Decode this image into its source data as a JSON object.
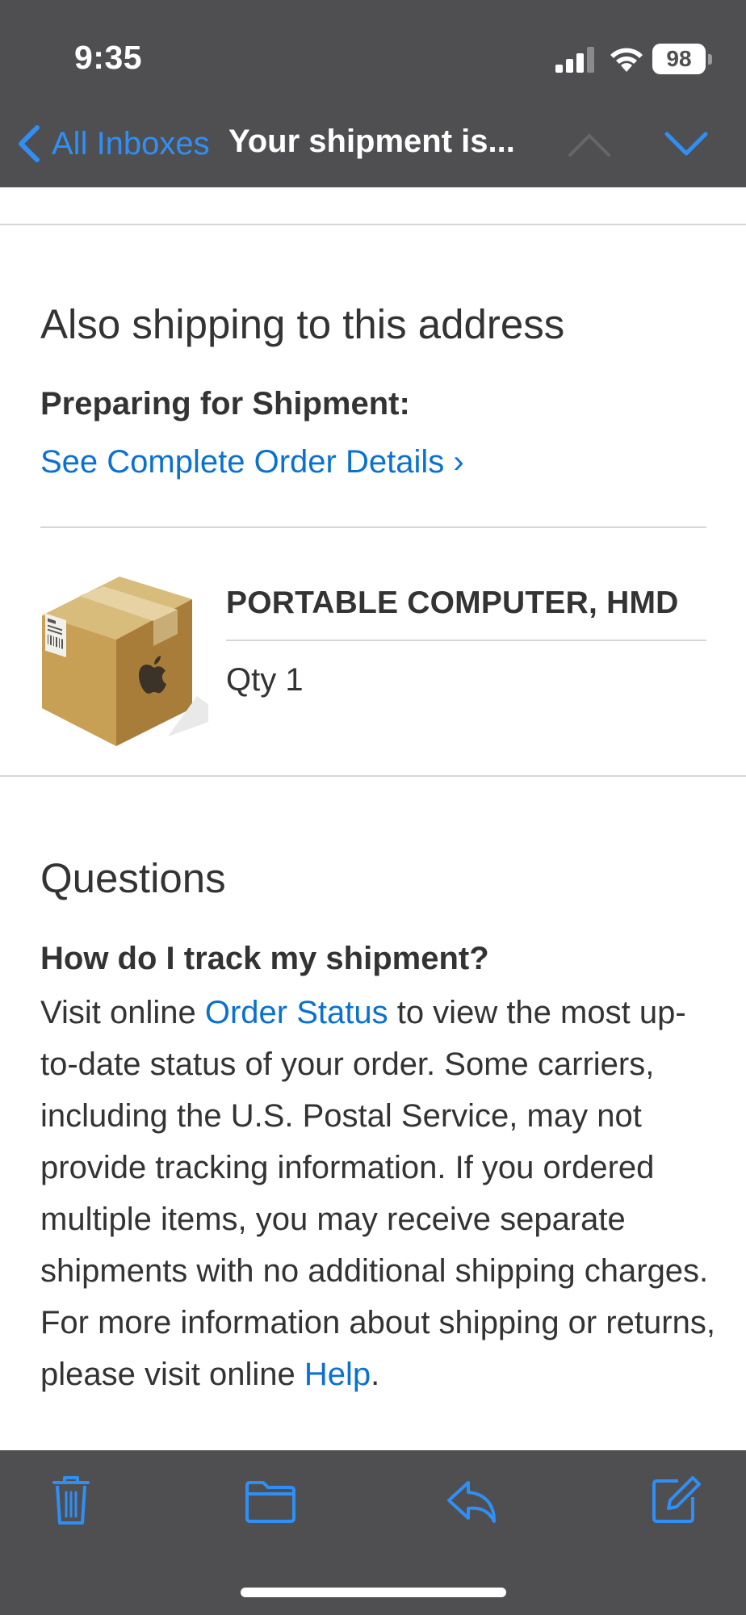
{
  "status_bar": {
    "time": "9:35",
    "battery_level": "98",
    "signal_bars": 3,
    "wifi": "on"
  },
  "nav": {
    "back_label": "All Inboxes",
    "title": "Your shipment is...",
    "prev_icon": "chevron-up-icon",
    "next_icon": "chevron-down-icon",
    "back_icon": "chevron-left-icon"
  },
  "shipping_section": {
    "heading": "Also shipping to this address",
    "status_label": "Preparing for Shipment:",
    "order_details_link": "See Complete Order Details ›"
  },
  "product": {
    "image": "shipping-box-image",
    "name": "PORTABLE COMPUTER, HMD",
    "quantity": "Qty 1"
  },
  "questions_section": {
    "heading": "Questions",
    "faq_question": "How do I track my shipment?",
    "faq_text_1": "Visit online ",
    "faq_link_1": "Order Status",
    "faq_text_2": " to view the most up-to-date status of your order. Some carriers, including the U.S. Postal Service, may not provide tracking information. If you ordered multiple items, you may receive separate shipments with no additional shipping charges. For more information about shipping or returns, please visit online ",
    "faq_link_2": "Help",
    "faq_text_3": "."
  },
  "toolbar": {
    "items": [
      "trash-icon",
      "folder-icon",
      "reply-icon",
      "compose-icon"
    ]
  },
  "colors": {
    "bar_background": "#4f4f51",
    "accent": "#2f8ff5",
    "link": "#0b71d0",
    "text": "#333333",
    "divider": "#d6d6d6"
  }
}
